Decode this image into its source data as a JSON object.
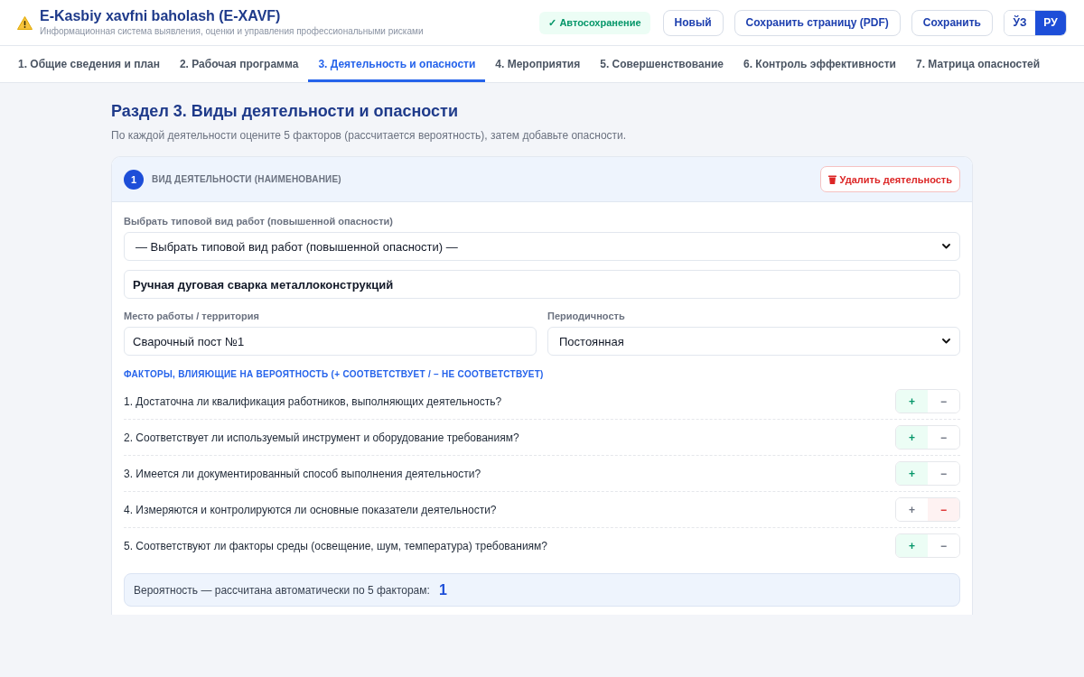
{
  "header": {
    "title": "E-Kasbiy xavfni baholash (E-XAVF)",
    "subtitle": "Информационная система выявления, оценки и управления профессиональными рисками",
    "autosave": "✓ Автосохранение",
    "buttons": [
      "Новый",
      "Сохранить страницу (PDF)",
      "Сохранить"
    ],
    "languages": [
      {
        "label": "ЎЗ",
        "selected": false
      },
      {
        "label": "РУ",
        "selected": true
      }
    ]
  },
  "tabs": [
    {
      "label": "1. Общие сведения и план",
      "selected": false
    },
    {
      "label": "2. Рабочая программа",
      "selected": false
    },
    {
      "label": "3. Деятельность и опасности",
      "selected": true
    },
    {
      "label": "4. Мероприятия",
      "selected": false
    },
    {
      "label": "5. Совершенствование",
      "selected": false
    },
    {
      "label": "6. Контроль эффективности",
      "selected": false
    },
    {
      "label": "7. Матрица опасностей",
      "selected": false
    }
  ],
  "section": {
    "title": "Раздел 3. Виды деятельности и опасности",
    "description": "По каждой деятельности оцените 5 факторов (рассчитается вероятность), затем добавьте опасности."
  },
  "activity": {
    "number": "1",
    "heading": "ВИД ДЕЯТЕЛЬНОСТИ (НАИМЕНОВАНИЕ)",
    "delete_button": "Удалить деятельность",
    "template_select": {
      "label": "Выбрать типовой вид работ (повышенной опасности)",
      "value": "— Выбрать типовой вид работ (повышенной опасности) —"
    },
    "name_field": {
      "value": "Ручная дуговая сварка металлоконструкций"
    },
    "place_field": {
      "label": "Место работы / территория",
      "value": "Сварочный пост №1"
    },
    "periodicity_select": {
      "label": "Периодичность",
      "value": "Постоянная"
    },
    "factors_heading": "ФАКТОРЫ, ВЛИЯЮЩИЕ НА ВЕРОЯТНОСТЬ (+ СООТВЕТСТВУЕТ / – НЕ СООТВЕТСТВУЕТ)",
    "factors": [
      {
        "text": "1. Достаточна ли квалификация работников, выполняющих деятельность?",
        "options": [
          {
            "kind": "positive",
            "label": "+",
            "selected": true
          },
          {
            "kind": "negative",
            "label": "−",
            "selected": false
          }
        ]
      },
      {
        "text": "2. Соответствует ли используемый инструмент и оборудование требованиям?",
        "options": [
          {
            "kind": "positive",
            "label": "+",
            "selected": true
          },
          {
            "kind": "negative",
            "label": "−",
            "selected": false
          }
        ]
      },
      {
        "text": "3. Имеется ли документированный способ выполнения деятельности?",
        "options": [
          {
            "kind": "positive",
            "label": "+",
            "selected": true
          },
          {
            "kind": "negative",
            "label": "−",
            "selected": false
          }
        ]
      },
      {
        "text": "4. Измеряются и контролируются ли основные показатели деятельности?",
        "options": [
          {
            "kind": "positive",
            "label": "+",
            "selected": false
          },
          {
            "kind": "negative",
            "label": "−",
            "selected": true
          }
        ]
      },
      {
        "text": "5. Соответствуют ли факторы среды (освещение, шум, температура) требованиям?",
        "options": [
          {
            "kind": "positive",
            "label": "+",
            "selected": true
          },
          {
            "kind": "negative",
            "label": "−",
            "selected": false
          }
        ]
      }
    ],
    "probability": {
      "label": "Вероятность — рассчитана автоматически по 5 факторам:",
      "value": "1"
    }
  }
}
